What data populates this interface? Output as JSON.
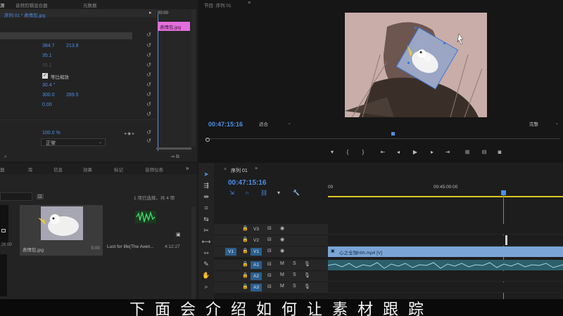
{
  "effect_controls": {
    "tabs": [
      "源",
      "音频剪辑混合器",
      "元数据"
    ],
    "sequence_title": "序列 01 * 表情包.jpg",
    "clip_label": "表情包.jpg",
    "position_x": "384.7",
    "position_y": "213.8",
    "scale": "35.1",
    "scale_width": "35.1",
    "uniform_scale_label": "等比缩放",
    "rotation": "30.4 °",
    "anchor_x": "300.0",
    "anchor_y": "289.5",
    "anti_flicker": "0.00",
    "opacity": "100.0 %",
    "blend_mode": "正常",
    "timecode": "00:00"
  },
  "program_monitor": {
    "title": "节目: 序列 01",
    "timecode": "00:47:15:16",
    "fit": "适合",
    "quality": "完整"
  },
  "project_panel": {
    "tabs": [
      "器",
      "库",
      "信息",
      "效果",
      "标记",
      "音频仪表"
    ],
    "status": "1 项已选择，共 4 项",
    "items": [
      {
        "name": "",
        "duration": ":26:00"
      },
      {
        "name": "表情包.jpg",
        "duration": "5:00"
      },
      {
        "name": "Lust for life(The Aven...",
        "duration": "4:12:27"
      }
    ]
  },
  "timeline": {
    "title": "序列 01",
    "timecode": "00:47:15:16",
    "ruler": [
      "00",
      "00:45:00:00"
    ],
    "tracks": [
      {
        "src": "",
        "label": "V3"
      },
      {
        "src": "",
        "label": "V2"
      },
      {
        "src": "V1",
        "label": "V1"
      },
      {
        "src": "",
        "label": "A1"
      },
      {
        "src": "",
        "label": "A2"
      },
      {
        "src": "",
        "label": "A3"
      }
    ],
    "video_clip": "心之全蚀hhh.mp4 [V]",
    "mute_label": "M",
    "solo_label": "S"
  },
  "caption": "下面会介绍如何让素材跟踪"
}
